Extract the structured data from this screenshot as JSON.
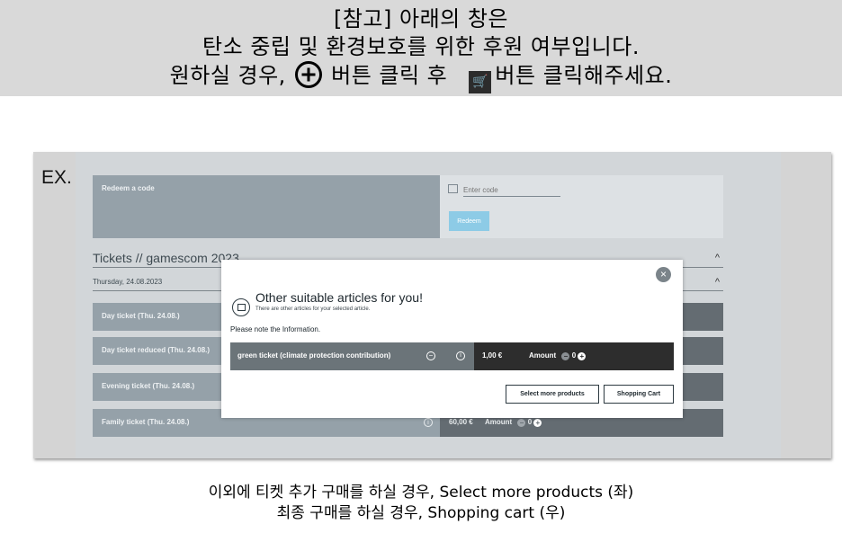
{
  "banner": {
    "line1": "[참고] 아래의 창은",
    "line2": "탄소 중립 및 환경보호를 위한 후원 여부입니다.",
    "line3_a": "원하실 경우,",
    "line3_b": "버튼 클릭 후",
    "line3_c": "버튼 클릭해주세요.",
    "plus_icon": "circled-plus-icon",
    "cart_icon": "cart-icon"
  },
  "example": {
    "label": "EX.",
    "redeem": {
      "title": "Redeem a code",
      "placeholder": "Enter code",
      "button": "Redeem"
    },
    "tickets_header": "Tickets // gamescom 2023",
    "date_header": "Thursday, 24.08.2023",
    "tickets": [
      {
        "name": "Day ticket (Thu. 24.08.)",
        "price": "",
        "amount_label": "",
        "qty": ""
      },
      {
        "name": "Day ticket reduced (Thu. 24.08.)",
        "price": "",
        "amount_label": "",
        "qty": ""
      },
      {
        "name": "Evening ticket (Thu. 24.08.)",
        "price": "",
        "amount_label": "",
        "qty": ""
      },
      {
        "name": "Family ticket (Thu. 24.08.)",
        "price": "60,00 €",
        "amount_label": "Amount",
        "qty": "0"
      }
    ],
    "modal": {
      "title": "Other suitable articles for you!",
      "subtitle": "There are other articles for your selected article.",
      "note": "Please note the Information.",
      "item_name": "green ticket (climate protection contribution)",
      "item_price": "1,00 €",
      "amount_label": "Amount",
      "qty": "0",
      "btn_more": "Select more products",
      "btn_cart": "Shopping Cart"
    }
  },
  "footer": {
    "line1": "이외에 티켓 추가 구매를 하실 경우,  Select more products (좌)",
    "line2": "최종 구매를 하실 경우,  Shopping cart  (우)"
  },
  "colors": {
    "banner_bg": "#d9d9d9",
    "row_name_bg": "#95a1a9",
    "row_dark_bg": "#646c72",
    "redeem_btn": "#8dcbe6",
    "modal_dark": "#2d2d2d"
  }
}
